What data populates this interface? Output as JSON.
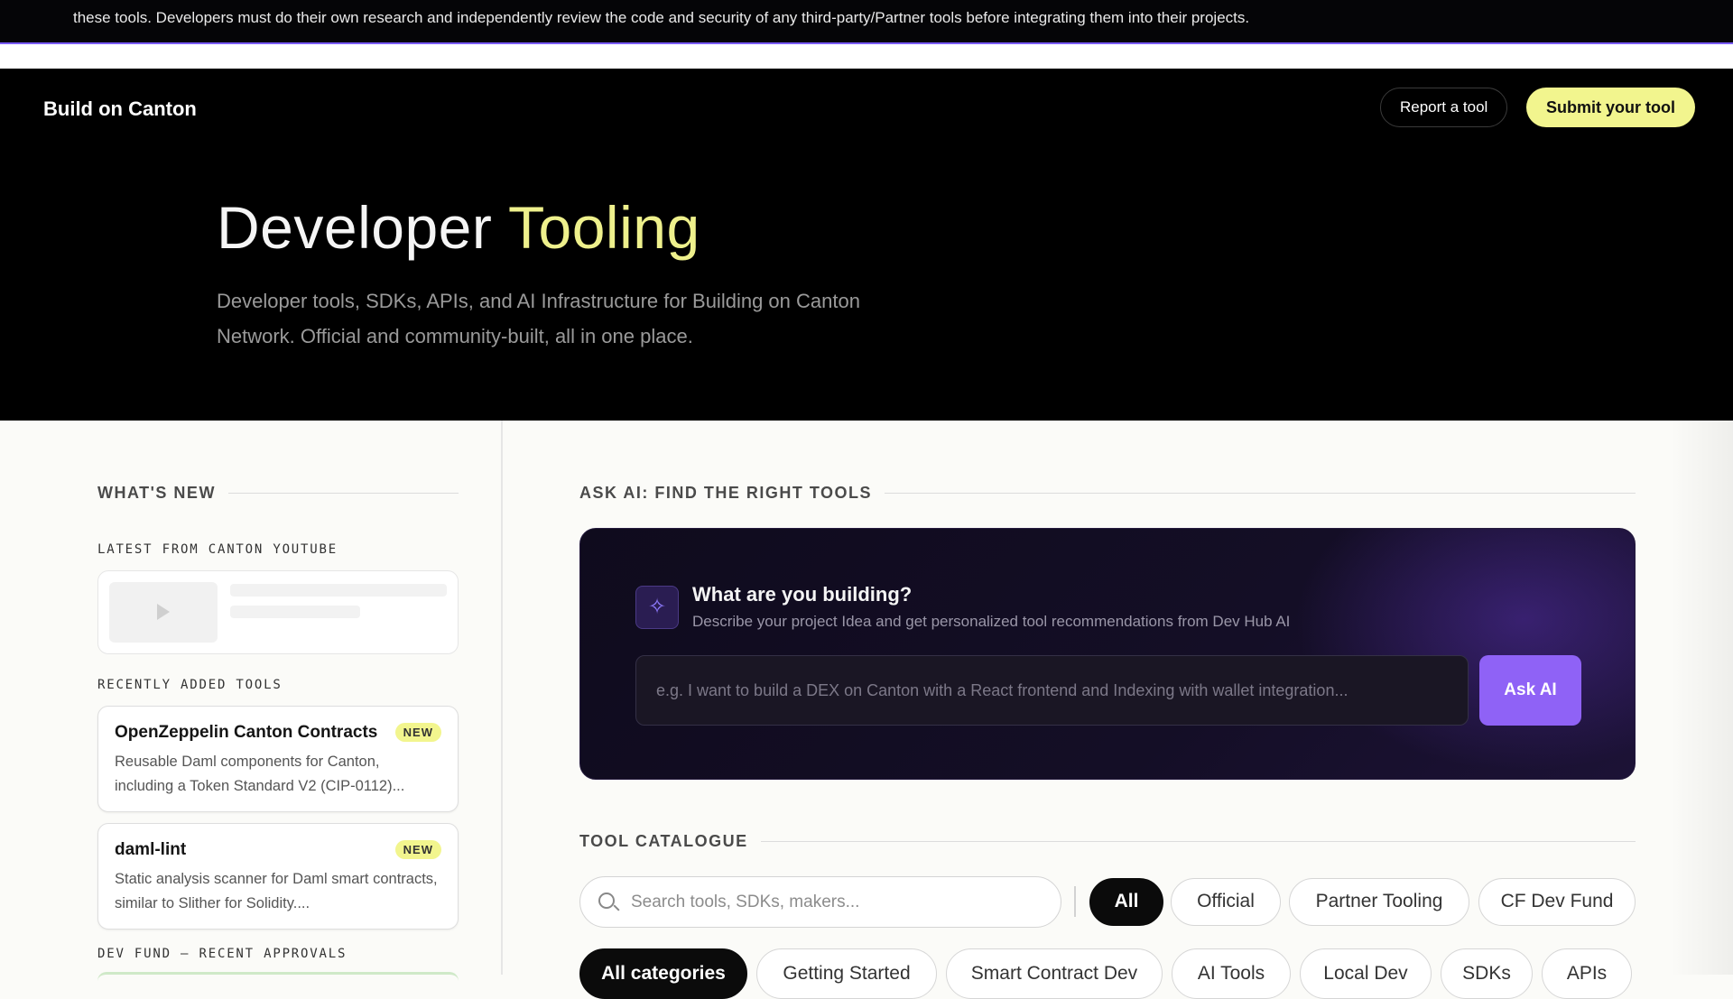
{
  "disclaimer": {
    "text": "these tools. Developers must do their own research and independently review the code and security of any third-party/Partner tools before integrating them into their projects."
  },
  "header": {
    "brand": "Build on Canton",
    "report_label": "Report a tool",
    "submit_label": "Submit your tool"
  },
  "hero": {
    "title_main": "Developer",
    "title_accent": "Tooling",
    "description": "Developer tools, SDKs, APIs, and AI Infrastructure for Building on Canton Network. Official and community-built, all in one place."
  },
  "whats_new": {
    "heading": "WHAT'S NEW",
    "youtube_heading": "LATEST FROM CANTON YOUTUBE",
    "recent_heading": "RECENTLY ADDED TOOLS",
    "tools": [
      {
        "name": "OpenZeppelin Canton Contracts",
        "badge": "NEW",
        "description": "Reusable Daml components for Canton, including a Token Standard V2 (CIP-0112)..."
      },
      {
        "name": "daml-lint",
        "badge": "NEW",
        "description": "Static analysis scanner for Daml smart contracts, similar to Slither for Solidity...."
      }
    ],
    "devfund_heading": "DEV FUND — RECENT APPROVALS"
  },
  "ask_ai": {
    "heading": "ASK AI: FIND THE RIGHT TOOLS",
    "title": "What are you building?",
    "subtitle": "Describe your project Idea and get personalized tool recommendations from Dev Hub AI",
    "placeholder": "e.g. I want to build a DEX on Canton with a React frontend and Indexing with wallet integration...",
    "button_label": "Ask AI"
  },
  "catalogue": {
    "heading": "TOOL CATALOGUE",
    "search_placeholder": "Search tools, SDKs, makers...",
    "filters": [
      "All",
      "Official",
      "Partner Tooling",
      "CF Dev Fund"
    ],
    "active_filter": "All",
    "categories": [
      "All categories",
      "Getting Started",
      "Smart Contract Dev",
      "AI Tools",
      "Local Dev",
      "SDKs",
      "APIs"
    ],
    "active_category": "All categories"
  },
  "colors": {
    "accent_yellow": "#f2f58e",
    "accent_purple": "#8f62f6",
    "hero_bg": "#000000"
  }
}
